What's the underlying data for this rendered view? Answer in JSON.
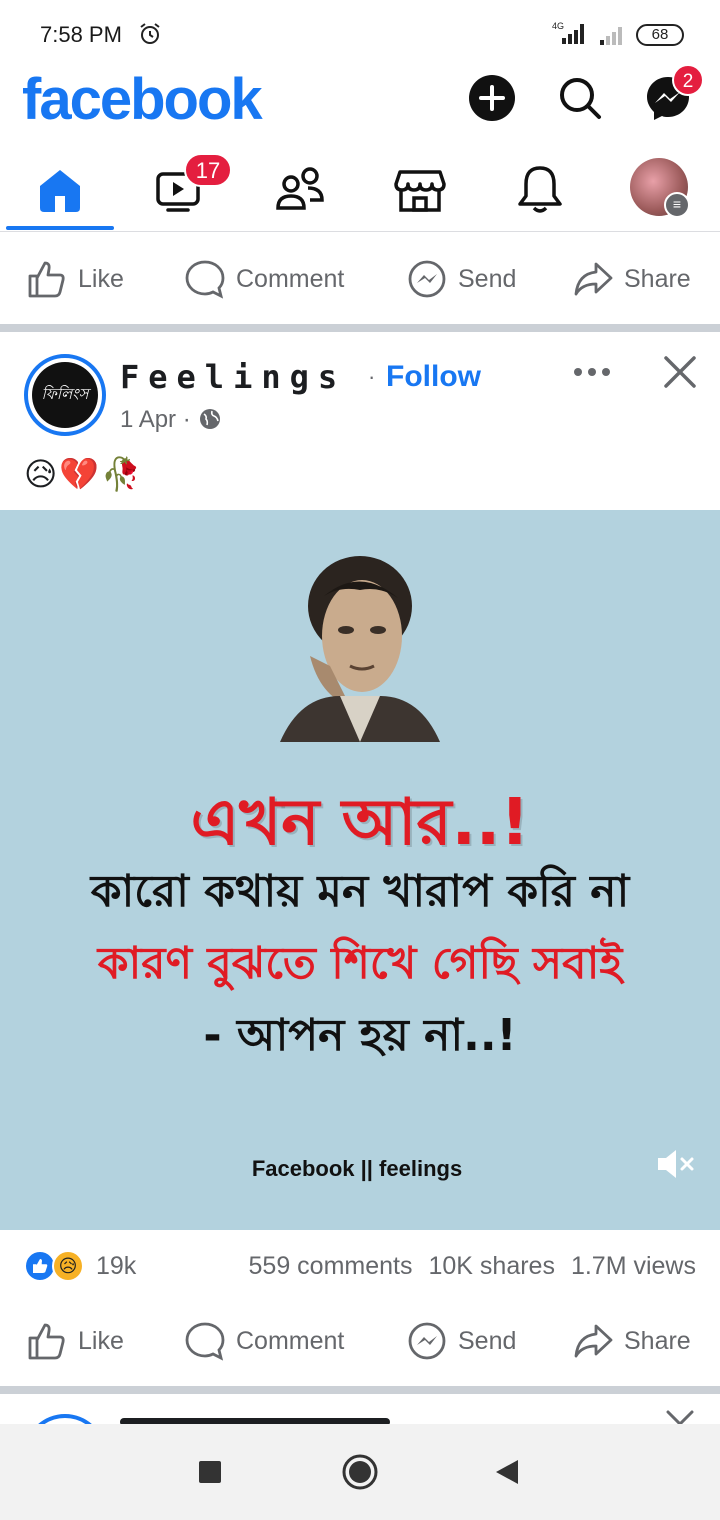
{
  "status_bar": {
    "time": "7:58 PM",
    "network_label": "4G",
    "battery": "68"
  },
  "header": {
    "logo": "facebook",
    "messenger_badge": "2"
  },
  "nav": {
    "video_badge": "17"
  },
  "actions": {
    "like": "Like",
    "comment": "Comment",
    "send": "Send",
    "share": "Share"
  },
  "post": {
    "page_name": "Feelings",
    "separator": "·",
    "follow": "Follow",
    "date": "1 Apr ·",
    "caption_emojis": [
      "😥",
      "💔",
      "🥀"
    ],
    "avatar_text": "ফিলিংস",
    "image": {
      "line1": "এখন আর..!",
      "line2": "কারো কথায় মন খারাপ করি না",
      "line3": "কারণ বুঝতে শিখে গেছি সবাই",
      "line4": "- আপন হয় না..!",
      "watermark": "Facebook || feelings",
      "background": "#b3d2de"
    },
    "stats": {
      "reactions": "19k",
      "comments": "559 comments",
      "shares": "10K shares",
      "views": "1.7M views"
    }
  },
  "colors": {
    "brand": "#1877f2",
    "badge": "#e41e3f",
    "muted_text": "#65676b",
    "quote_red": "#e01b24"
  },
  "icons": {
    "alarm": "alarm-icon",
    "add": "plus-circle-icon",
    "search": "search-icon",
    "messenger": "messenger-icon",
    "home": "home-icon",
    "video": "video-icon",
    "friends": "friends-icon",
    "marketplace": "marketplace-icon",
    "notifications": "bell-icon"
  }
}
